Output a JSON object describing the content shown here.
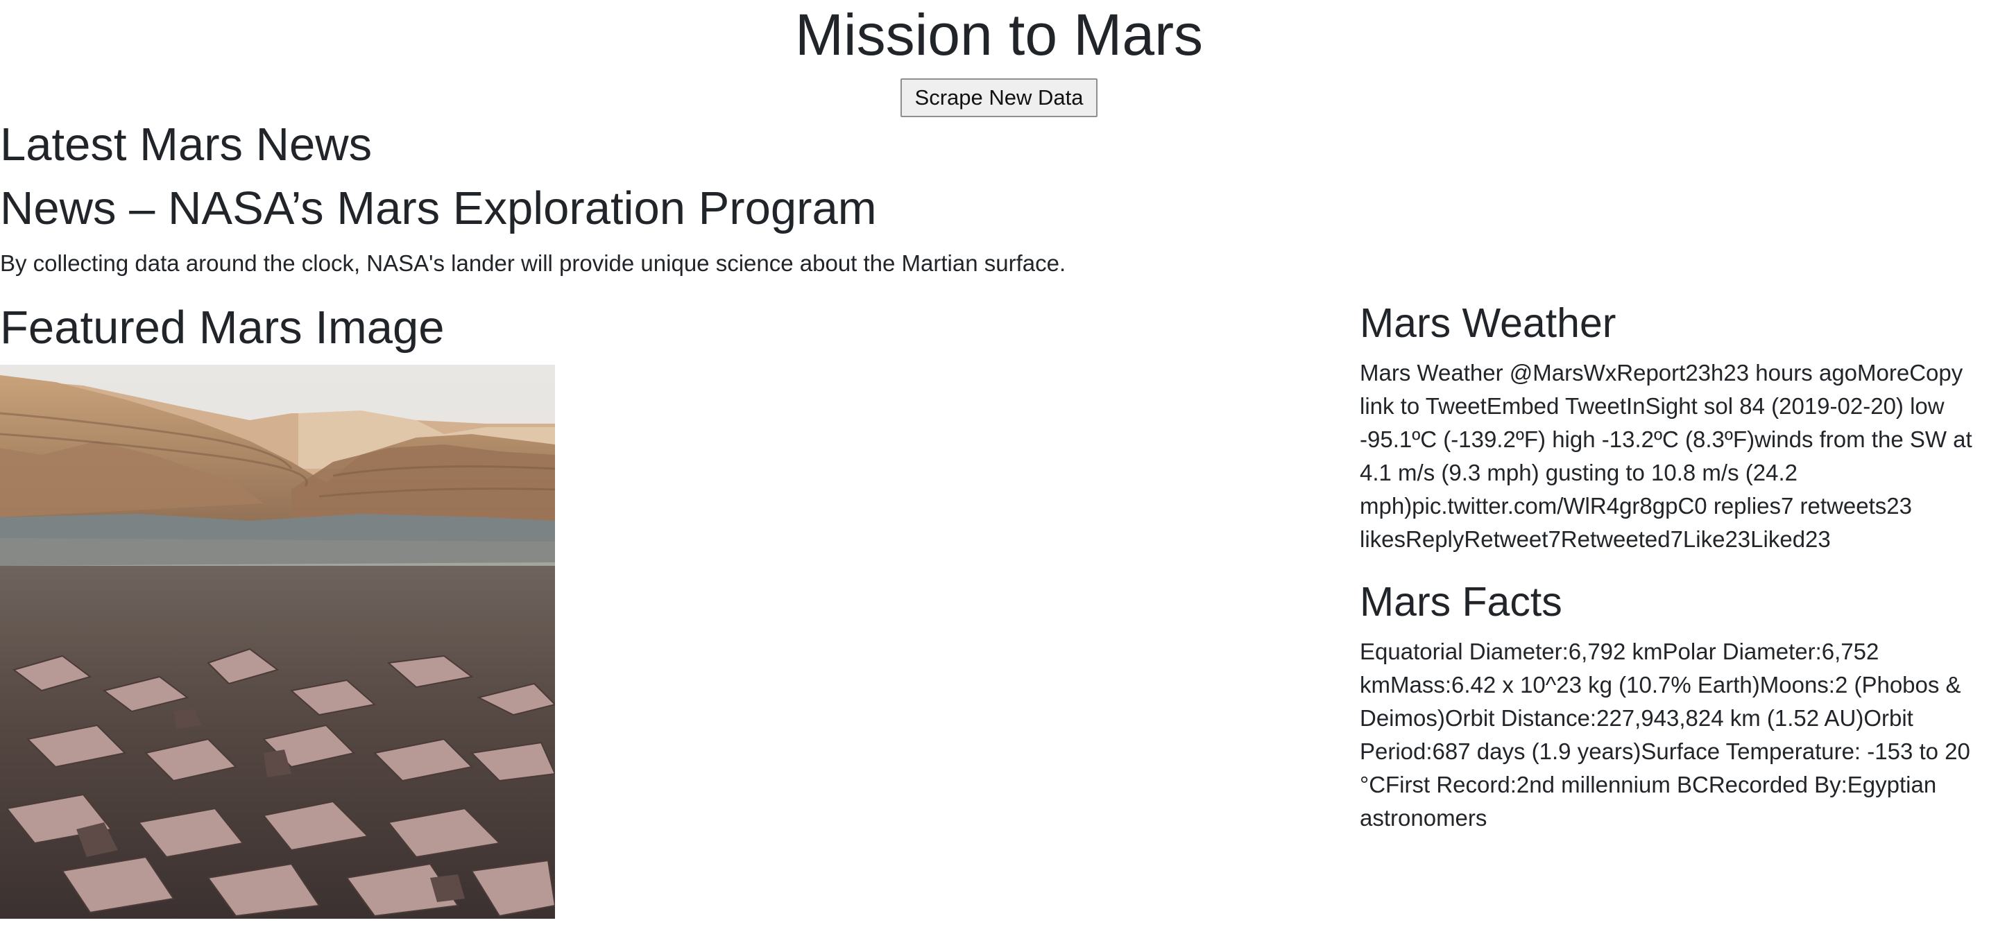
{
  "header": {
    "title": "Mission to Mars",
    "scrape_button_label": "Scrape New Data"
  },
  "news": {
    "section_heading": "Latest Mars News",
    "title": "News – NASA’s Mars Exploration Program",
    "paragraph": "By collecting data around the clock, NASA's lander will provide unique science about the Martian surface."
  },
  "featured": {
    "section_heading": "Featured Mars Image",
    "image_subject": "Martian rocky landscape with layered buttes"
  },
  "weather": {
    "section_heading": "Mars Weather",
    "text": "Mars Weather @MarsWxReport23h23 hours agoMoreCopy link to TweetEmbed TweetInSight sol 84 (2019-02-20) low -95.1ºC (-139.2ºF) high -13.2ºC (8.3ºF)winds from the SW at 4.1 m/s (9.3 mph) gusting to 10.8 m/s (24.2 mph)pic.twitter.com/WlR4gr8gpC0 replies7 retweets23 likesReplyRetweet7Retweeted7Like23Liked23"
  },
  "facts": {
    "section_heading": "Mars Facts",
    "text": "Equatorial Diameter:6,792 kmPolar Diameter:6,752 kmMass:6.42 x 10^23 kg (10.7% Earth)Moons:2 (Phobos & Deimos)Orbit Distance:227,943,824 km (1.52 AU)Orbit Period:687 days (1.9 years)Surface Temperature: -153 to 20 °CFirst Record:2nd millennium BCRecorded By:Egyptian astronomers"
  },
  "colors": {
    "text": "#212529",
    "button_bg": "#efefef",
    "button_border": "#8f8f8f"
  }
}
